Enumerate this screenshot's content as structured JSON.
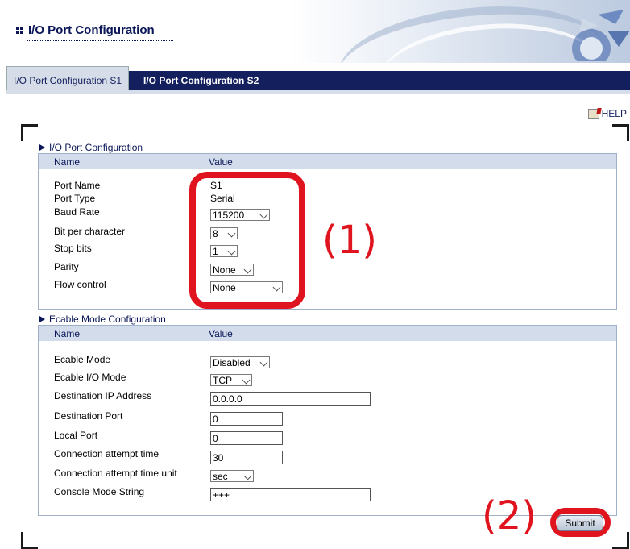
{
  "header": {
    "title": "I/O Port Configuration"
  },
  "tabs": [
    {
      "label": "I/O Port Configuration S1",
      "active": true
    },
    {
      "label": "I/O Port Configuration S2",
      "active": false
    }
  ],
  "help": {
    "label": "HELP",
    "icon": "help-book-icon"
  },
  "io_section": {
    "title": "I/O Port Configuration",
    "col_name": "Name",
    "col_value": "Value",
    "rows": [
      {
        "label": "Port Name",
        "value": "S1"
      },
      {
        "label": "Port Type",
        "value": "Serial"
      },
      {
        "label": "Baud Rate",
        "value": "115200"
      },
      {
        "label": "Bit per character",
        "value": "8"
      },
      {
        "label": "Stop bits",
        "value": "1"
      },
      {
        "label": "Parity",
        "value": "None"
      },
      {
        "label": "Flow control",
        "value": "None"
      }
    ]
  },
  "ecable_section": {
    "title": "Ecable Mode Configuration",
    "col_name": "Name",
    "col_value": "Value",
    "rows": [
      {
        "label": "Ecable Mode",
        "value": "Disabled"
      },
      {
        "label": "Ecable I/O Mode",
        "value": "TCP"
      },
      {
        "label": "Destination IP Address",
        "value": "0.0.0.0"
      },
      {
        "label": "Destination Port",
        "value": "0"
      },
      {
        "label": "Local Port",
        "value": "0"
      },
      {
        "label": "Connection attempt time",
        "value": "30"
      },
      {
        "label": "Connection attempt time unit",
        "value": "sec"
      },
      {
        "label": "Console Mode String",
        "value": "+++"
      }
    ]
  },
  "submit": {
    "label": "Submit"
  },
  "annotations": {
    "label1": "(1)",
    "label2": "(2)",
    "color": "#e0141e"
  }
}
